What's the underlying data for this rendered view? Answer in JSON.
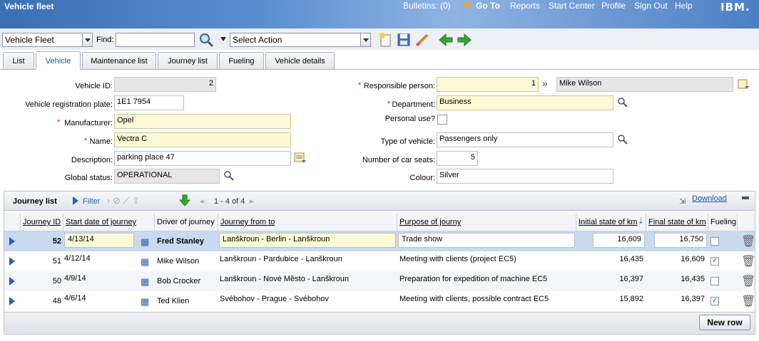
{
  "header": {
    "title": "Vehicle fleet",
    "bulletins": "Bulletins: (0)",
    "goto": "Go To",
    "reports": "Reports",
    "start_center": "Start Center",
    "profile": "Profile",
    "sign_out": "Sign Out",
    "help": "Help",
    "brand": "IBM."
  },
  "toolbar": {
    "app_select": "Vehicle Fleet",
    "find_label": "Find:",
    "find_value": "",
    "action_select": "Select Action"
  },
  "tabs": [
    "List",
    "Vehicle",
    "Maintenance list",
    "Journey list",
    "Fueling",
    "Vehicle details"
  ],
  "form": {
    "vehicle_id_label": "Vehicle ID:",
    "vehicle_id": "2",
    "reg_plate_label": "Vehicle registration plate:",
    "reg_plate": "1E1 7954",
    "manufacturer_label": "Manufacturer:",
    "manufacturer": "Opel",
    "name_label": "Name:",
    "name": "Vectra C",
    "description_label": "Description:",
    "description": "parking place 47",
    "global_status_label": "Global status:",
    "global_status": "OPERATIONAL",
    "responsible_label": "Responsible person:",
    "responsible_id": "1",
    "responsible_name": "Mike Wilson",
    "department_label": "Department:",
    "department": "Business",
    "personal_use_label": "Personal use?",
    "type_label": "Type of vehicle:",
    "type": "Passengers only",
    "seats_label": "Number of car seats:",
    "seats": "5",
    "colour_label": "Colour:",
    "colour": "Silver",
    "required_mark": "*"
  },
  "journey": {
    "title": "Journey list",
    "filter": "Filter",
    "pager": "1 - 4 of 4",
    "download": "Download",
    "columns": [
      "Journey ID",
      "Start date of journey",
      "Driver of journey",
      "Journey from to",
      "Purpose of journy",
      "Initial state of km",
      "Final state of km",
      "Fueling"
    ],
    "rows": [
      {
        "id": "52",
        "date": "4/13/14",
        "driver": "Fred Stanley",
        "route": "Lanškroun - Berlin - Lanškroun",
        "purpose": "Trade show",
        "initial": "16,609",
        "final": "16,750",
        "fueling": false
      },
      {
        "id": "51",
        "date": "4/12/14",
        "driver": "Mike Wilson",
        "route": "Lanškroun - Pardubice - Lanškroun",
        "purpose": "Meeting with clients (project EC5)",
        "initial": "16,435",
        "final": "16,609",
        "fueling": true
      },
      {
        "id": "50",
        "date": "4/9/14",
        "driver": "Bob Crocker",
        "route": "Lanškroun - Nové Město - Lanškroun",
        "purpose": "Preparation for expedition of machine EC5",
        "initial": "16,397",
        "final": "16,435",
        "fueling": false
      },
      {
        "id": "48",
        "date": "4/6/14",
        "driver": "Ted Klien",
        "route": "Svébohov - Prague - Svébohov",
        "purpose": "Meeting with clients, possible contract EC5",
        "initial": "15,892",
        "final": "16,397",
        "fueling": true
      }
    ],
    "new_row": "New row"
  },
  "colors": {
    "accent": "#2d5fb0",
    "required_bg": "#fdf9d6",
    "selected_row": "#c9d9f0"
  }
}
